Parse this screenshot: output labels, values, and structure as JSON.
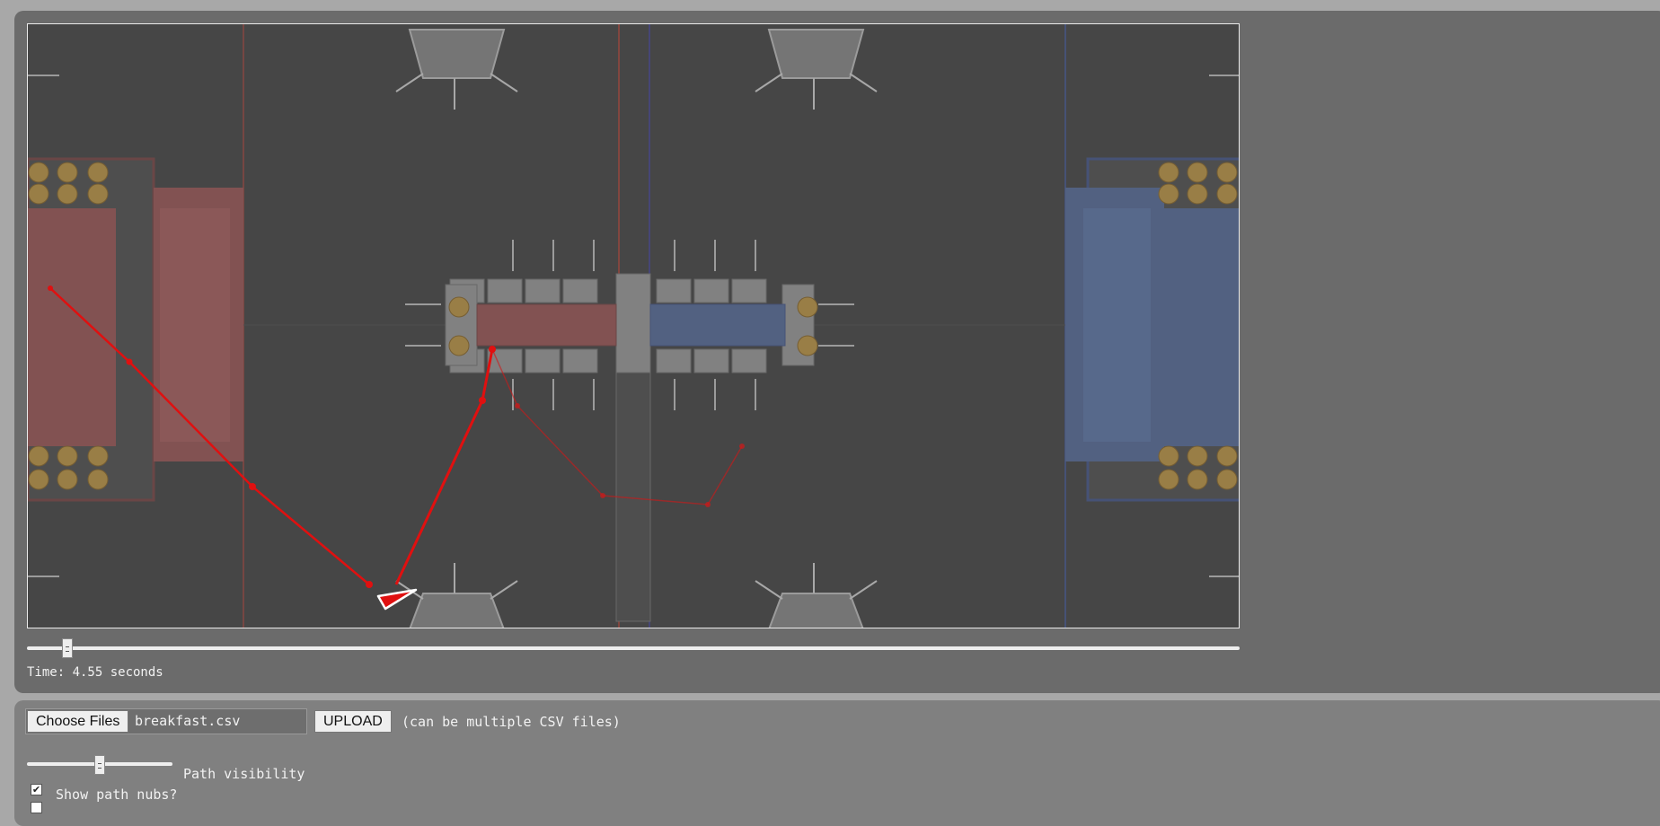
{
  "viewer": {
    "time_label": "Time: 4.55 seconds",
    "time_slider_fraction": 0.033
  },
  "upload": {
    "choose_label": "Choose Files",
    "file_name": "breakfast.csv",
    "upload_label": "UPLOAD",
    "hint": "(can be multiple CSV files)"
  },
  "options": {
    "path_visibility_label": "Path visibility",
    "path_visibility_fraction": 0.5,
    "show_nubs_label": "Show path nubs?",
    "show_nubs_checked": true
  },
  "colors": {
    "path": "#e01010",
    "red_alliance": "#9a5a5a",
    "blue_alliance": "#5a6e99",
    "field": "#4a4a4a"
  }
}
